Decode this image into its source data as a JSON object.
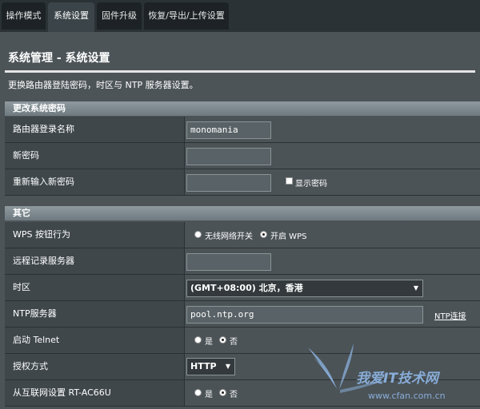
{
  "tabs": [
    {
      "label": "操作模式"
    },
    {
      "label": "系统设置"
    },
    {
      "label": "固件升级"
    },
    {
      "label": "恢复/导出/上传设置"
    }
  ],
  "page_title": "系统管理 - 系统设置",
  "description": "更换路由器登陆密码，时区与 NTP 服务器设置。",
  "section_password": {
    "title": "更改系统密码",
    "login_name_label": "路由器登录名称",
    "login_name_value": "monomania",
    "new_password_label": "新密码",
    "new_password_value": "",
    "retype_label": "重新输入新密码",
    "retype_value": "",
    "show_password_label": "显示密码"
  },
  "section_misc": {
    "title": "其它",
    "wps_label": "WPS 按钮行为",
    "wps_options": [
      "无线网络开关",
      "开启 WPS"
    ],
    "wps_selected": "开启 WPS",
    "remote_log_label": "远程记录服务器",
    "remote_log_value": "",
    "timezone_label": "时区",
    "timezone_value": "(GMT+08:00) 北京，香港",
    "ntp_label": "NTP服务器",
    "ntp_value": "pool.ntp.org",
    "ntp_link": "NTP连接",
    "telnet_label": "启动 Telnet",
    "telnet_options": [
      "是",
      "否"
    ],
    "telnet_selected": "否",
    "auth_label": "授权方式",
    "auth_value": "HTTP",
    "wan_access_label": "从互联网设置 RT-AC66U",
    "wan_access_options": [
      "是",
      "否"
    ],
    "wan_access_selected": "否"
  },
  "watermark": {
    "text_main": "我爱IT技术网",
    "text_url": "www.cfan.com.cn",
    "color": "#8fb7e6"
  },
  "colors": {
    "background": "#3a4449",
    "section_header": "#8e9a9f",
    "label_cell": "#3f474b"
  }
}
